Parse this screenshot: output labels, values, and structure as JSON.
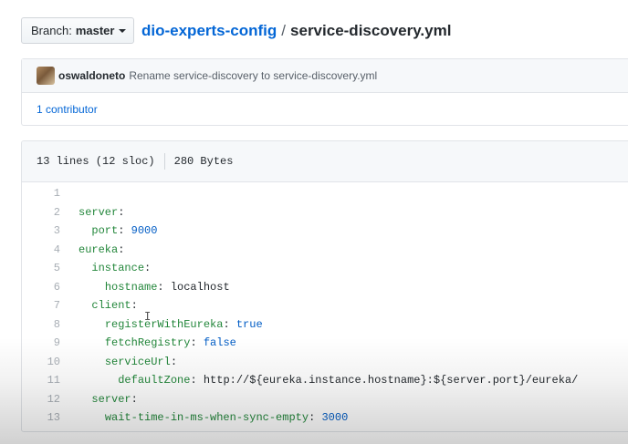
{
  "branch": {
    "prefix": "Branch:",
    "name": "master"
  },
  "breadcrumb": {
    "repo": "dio-experts-config",
    "separator": "/",
    "file": "service-discovery.yml"
  },
  "commit": {
    "author": "oswaldoneto",
    "message": "Rename service-discovery to service-discovery.yml",
    "contributors": "1 contributor"
  },
  "file": {
    "lines_info": "13 lines (12 sloc)",
    "size": "280 Bytes",
    "code": [
      {
        "num": "1",
        "indent": "",
        "key": "",
        "value": "",
        "vtype": "plain"
      },
      {
        "num": "2",
        "indent": "",
        "key": "server",
        "value": "",
        "vtype": "plain"
      },
      {
        "num": "3",
        "indent": "  ",
        "key": "port",
        "value": "9000",
        "vtype": "num"
      },
      {
        "num": "4",
        "indent": "",
        "key": "eureka",
        "value": "",
        "vtype": "plain"
      },
      {
        "num": "5",
        "indent": "  ",
        "key": "instance",
        "value": "",
        "vtype": "plain"
      },
      {
        "num": "6",
        "indent": "    ",
        "key": "hostname",
        "value": "localhost",
        "vtype": "plain"
      },
      {
        "num": "7",
        "indent": "  ",
        "key": "client",
        "value": "",
        "vtype": "plain"
      },
      {
        "num": "8",
        "indent": "    ",
        "key": "registerWithEureka",
        "value": "true",
        "vtype": "num"
      },
      {
        "num": "9",
        "indent": "    ",
        "key": "fetchRegistry",
        "value": "false",
        "vtype": "num"
      },
      {
        "num": "10",
        "indent": "    ",
        "key": "serviceUrl",
        "value": "",
        "vtype": "plain"
      },
      {
        "num": "11",
        "indent": "      ",
        "key": "defaultZone",
        "value": "http://${eureka.instance.hostname}:${server.port}/eureka/",
        "vtype": "plain"
      },
      {
        "num": "12",
        "indent": "  ",
        "key": "server",
        "value": "",
        "vtype": "plain"
      },
      {
        "num": "13",
        "indent": "    ",
        "key": "wait-time-in-ms-when-sync-empty",
        "value": "3000",
        "vtype": "num"
      }
    ]
  }
}
